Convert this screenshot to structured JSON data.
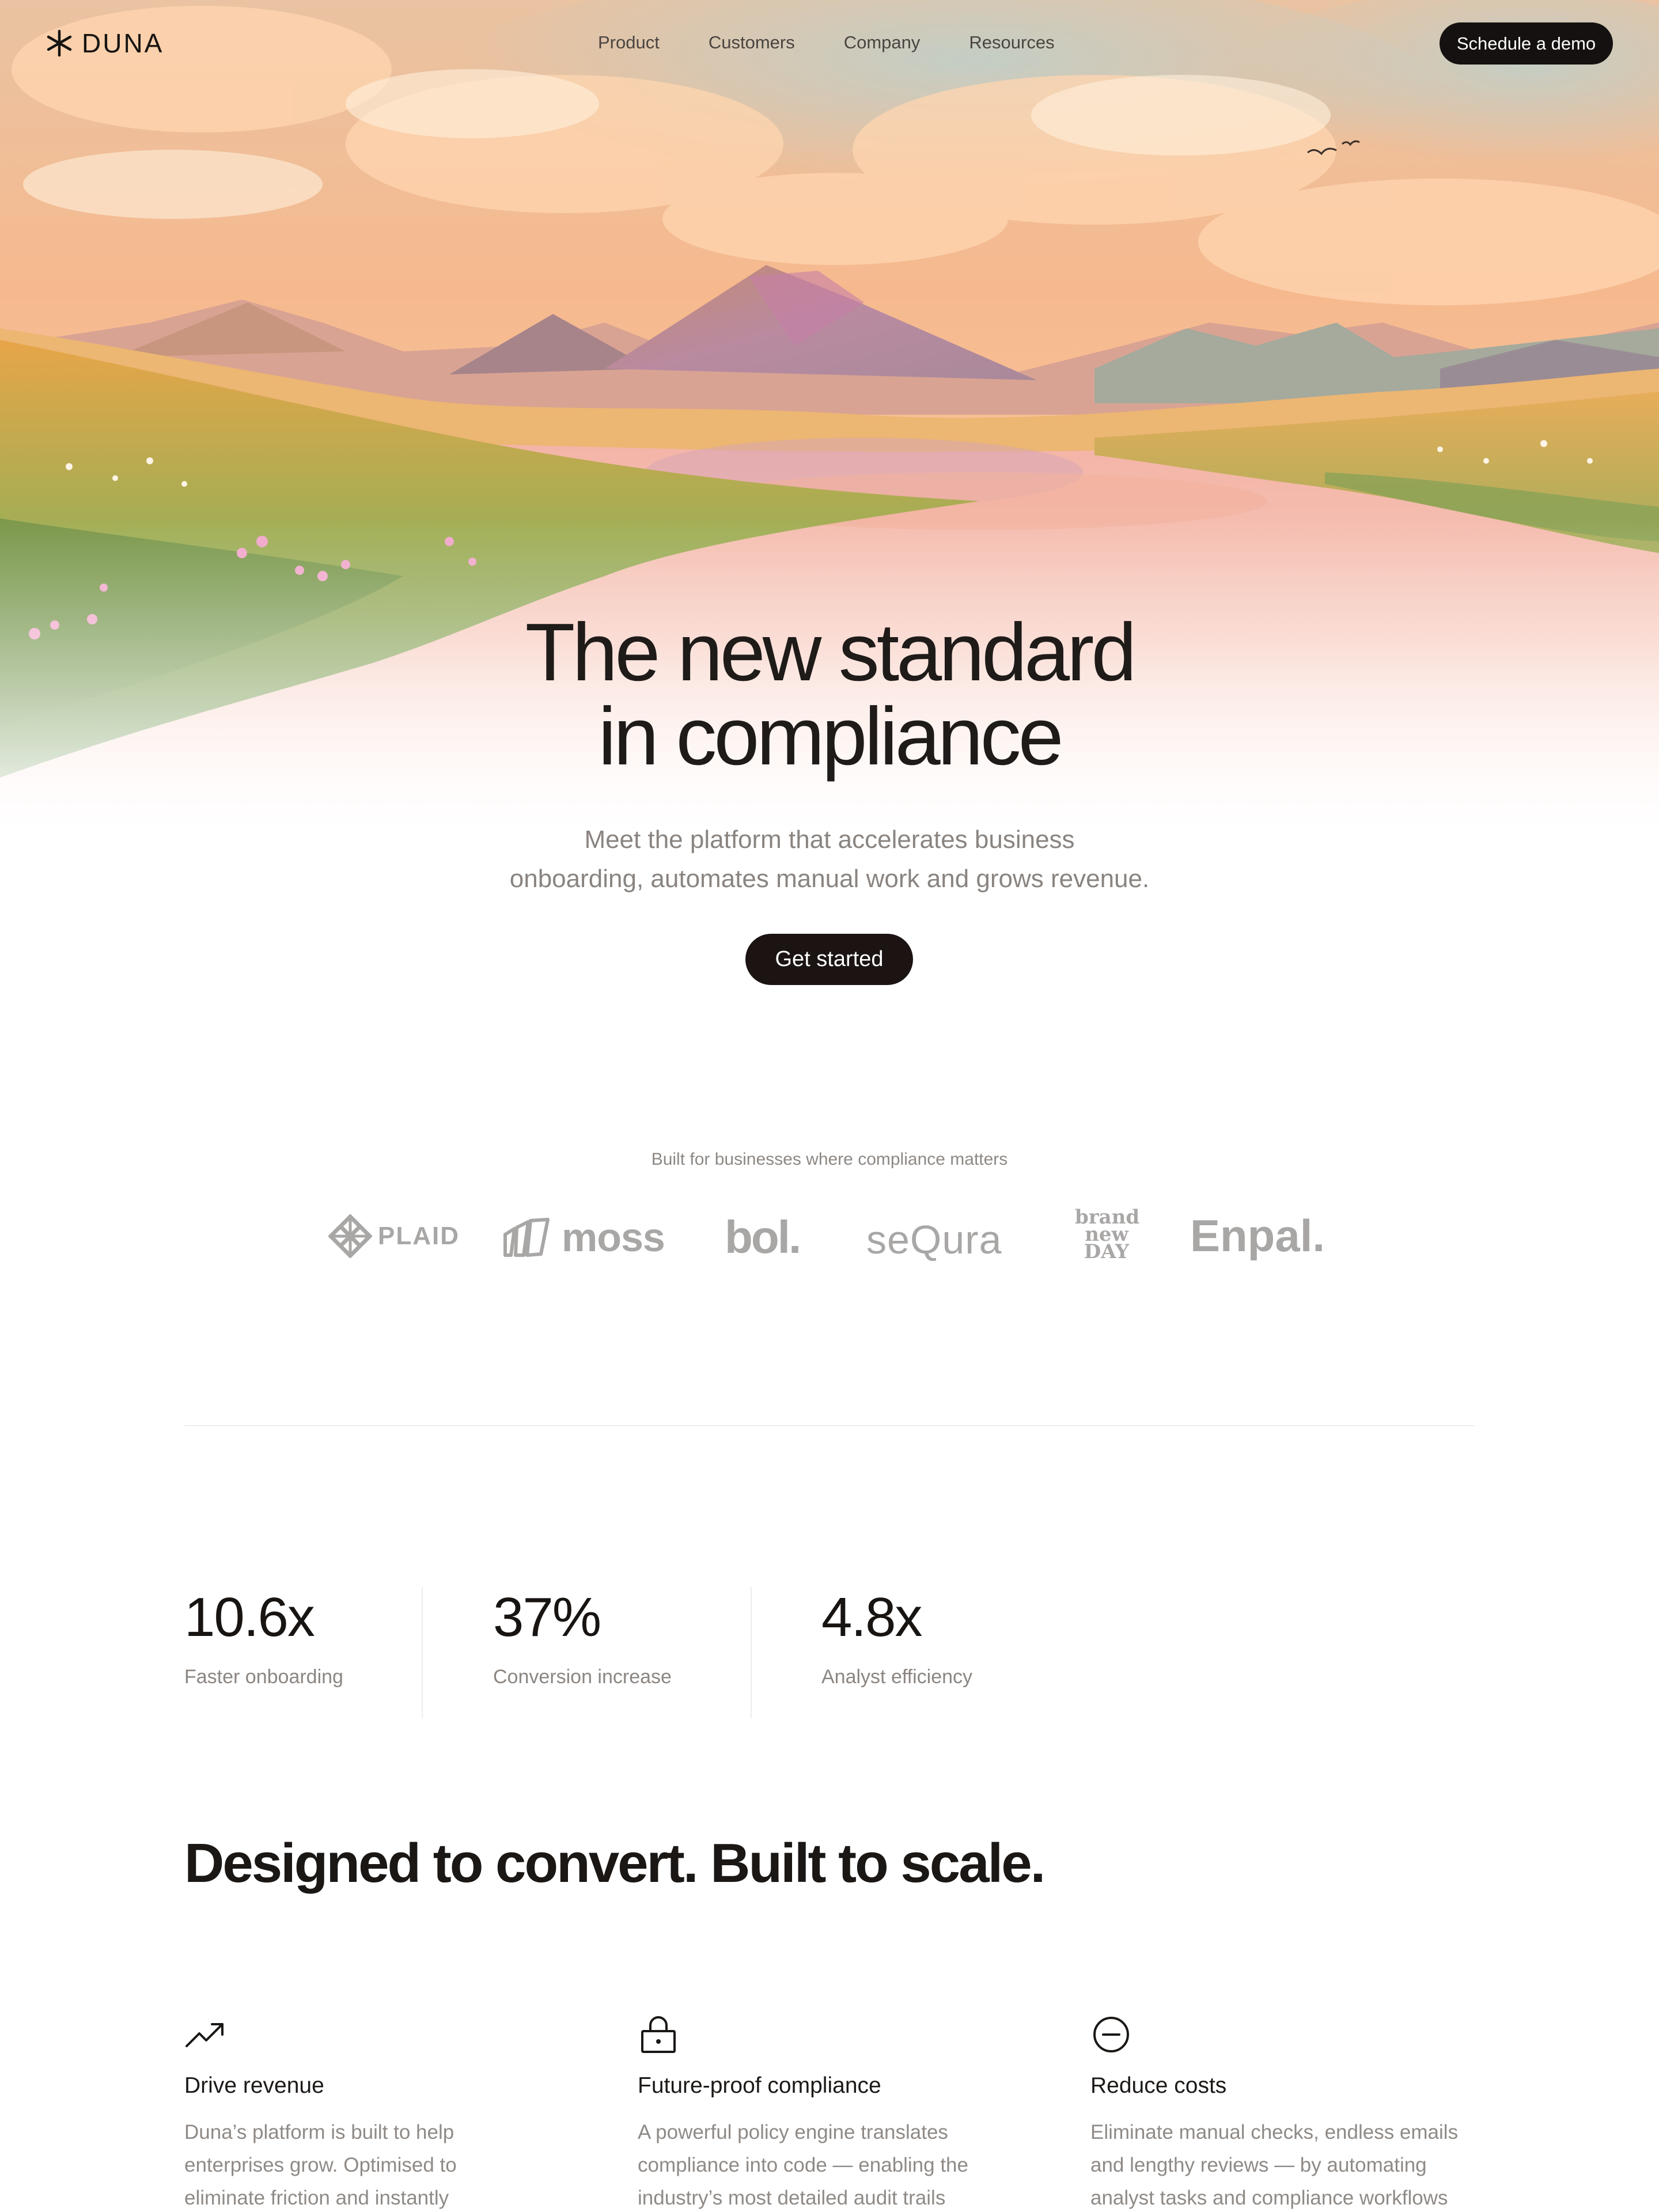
{
  "nav": {
    "brand": "DUNA",
    "menu": [
      "Product",
      "Customers",
      "Company",
      "Resources"
    ],
    "demo_label": "Schedule a demo"
  },
  "hero": {
    "title_line1": "The new standard",
    "title_line2": "in compliance",
    "subtitle_line1": "Meet the platform that accelerates business",
    "subtitle_line2": "onboarding, automates manual work and grows revenue.",
    "cta_label": "Get started"
  },
  "customers": {
    "caption": "Built for businesses where compliance matters",
    "logos": [
      {
        "name": "PLAID",
        "icon": "plaid-logo-icon"
      },
      {
        "name": "moss",
        "icon": "moss-logo-icon"
      },
      {
        "name": "bol.",
        "icon": "bol-logo"
      },
      {
        "name": "seQura",
        "icon": "sequra-logo"
      },
      {
        "name": "brand new DAY",
        "icon": "brand-new-day-logo"
      },
      {
        "name": "Enpal.",
        "icon": "enpal-logo"
      }
    ]
  },
  "stats": [
    {
      "value": "10.6x",
      "label": "Faster onboarding"
    },
    {
      "value": "37%",
      "label": "Conversion increase"
    },
    {
      "value": "4.8x",
      "label": "Analyst efficiency"
    }
  ],
  "features": {
    "title": "Designed to convert. Built to scale.",
    "items": [
      {
        "icon": "trending-up-icon",
        "title": "Drive revenue",
        "desc": "Duna’s platform is built to help enterprises grow. Optimised to eliminate friction and instantly"
      },
      {
        "icon": "lock-icon",
        "title": "Future-proof compliance",
        "desc": "A powerful policy engine translates compliance into code — enabling the industry’s most detailed audit trails"
      },
      {
        "icon": "minus-circle-icon",
        "title": "Reduce costs",
        "desc": "Eliminate manual checks, endless emails and lengthy reviews — by automating analyst tasks and compliance workflows"
      }
    ]
  },
  "colors": {
    "primary_button": "#151110",
    "text_muted": "#8c8682",
    "logo_gray": "#a9a7a6"
  }
}
